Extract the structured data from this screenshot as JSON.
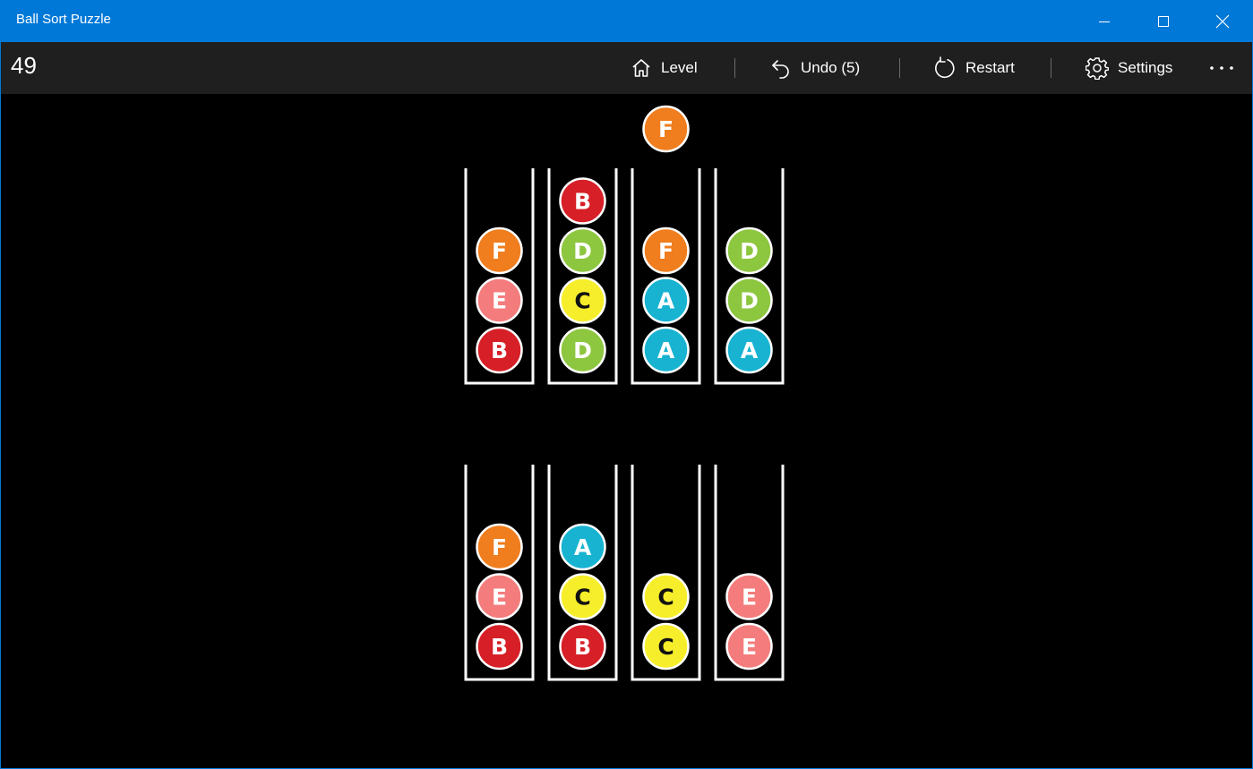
{
  "window": {
    "title": "Ball Sort Puzzle"
  },
  "toolbar": {
    "score": "49",
    "level_label": "Level",
    "undo_label": "Undo (5)",
    "restart_label": "Restart",
    "settings_label": "Settings"
  },
  "colors": {
    "A": "#17b3d1",
    "B": "#d61f26",
    "C": "#f6ee2a",
    "D": "#8dc63f",
    "E": "#f47c7c",
    "F": "#f07d1e",
    "titlebar": "#0078d7",
    "commandbar": "#1f1f1f",
    "board": "#000000"
  },
  "game": {
    "tube_capacity": 4,
    "held_ball": "F",
    "rows": [
      [
        [
          "B",
          "E",
          "F"
        ],
        [
          "D",
          "C",
          "D",
          "B"
        ],
        [
          "A",
          "A",
          "F"
        ],
        [
          "A",
          "D",
          "D"
        ]
      ],
      [
        [
          "B",
          "E",
          "F"
        ],
        [
          "B",
          "C",
          "A"
        ],
        [
          "C",
          "C"
        ],
        [
          "E",
          "E"
        ]
      ]
    ]
  }
}
